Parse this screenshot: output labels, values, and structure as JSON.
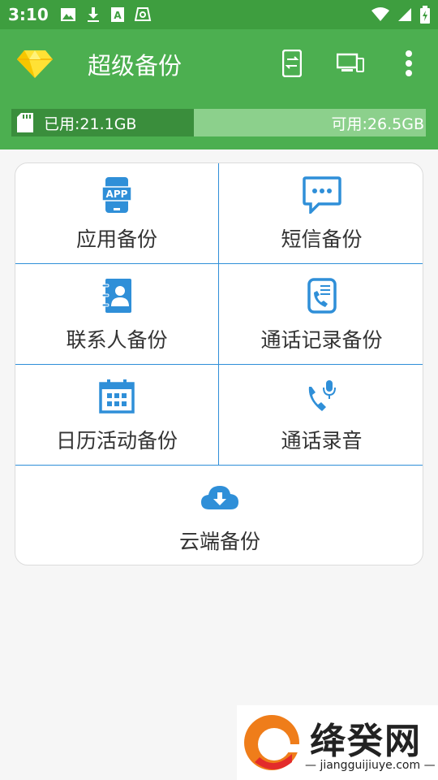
{
  "status_bar": {
    "time": "3:10",
    "icons_left": [
      "image-icon",
      "download-icon",
      "a-box-icon",
      "sync-icon"
    ],
    "icons_right": [
      "wifi-icon",
      "signal-icon",
      "battery-icon"
    ]
  },
  "app_bar": {
    "title": "超级备份",
    "logo": "diamond-icon",
    "actions": [
      "phone-transfer-icon",
      "devices-icon",
      "more-vert-icon"
    ]
  },
  "storage": {
    "used_label": "已用:21.1GB",
    "free_label": "可用:26.5GB",
    "used_fraction": 0.44
  },
  "menu": {
    "app_backup": "应用备份",
    "sms_backup": "短信备份",
    "contacts_backup": "联系人备份",
    "call_log_backup": "通话记录备份",
    "calendar_backup": "日历活动备份",
    "call_recording": "通话录音",
    "cloud_backup": "云端备份",
    "app_icon_text": "APP"
  },
  "colors": {
    "appbar": "#4caf50",
    "statusbar": "#3e9e3f",
    "accent_blue": "#2f8fd8"
  },
  "watermark": {
    "text": "绛癸网",
    "url": "jiangguijiuye.com"
  }
}
